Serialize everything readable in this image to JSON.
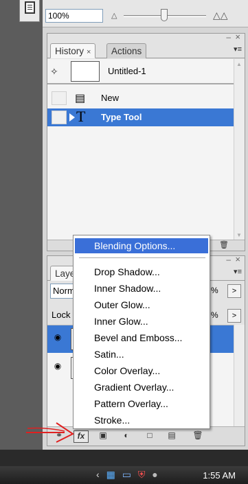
{
  "navigator": {
    "zoom_value": "100%",
    "zoom_out_icon": "mountain-small-icon",
    "zoom_in_icon": "mountain-large-icon"
  },
  "history_panel": {
    "tabs": [
      {
        "label": "History"
      },
      {
        "label": "Actions"
      }
    ],
    "snapshot_label": "Untitled-1",
    "items": [
      {
        "label": "New",
        "icon": "document-icon"
      },
      {
        "label": "Type Tool",
        "icon": "type-tool-icon",
        "selected": true
      }
    ]
  },
  "layers_panel": {
    "tab_label": "Laye",
    "blend_mode": "Norm",
    "opacity": "%",
    "lock_label": "Lock",
    "fill": "%"
  },
  "context_menu": {
    "items": [
      {
        "label": "Blending Options...",
        "highlighted": true
      },
      {
        "label": "Drop Shadow..."
      },
      {
        "label": "Inner Shadow..."
      },
      {
        "label": "Outer Glow..."
      },
      {
        "label": "Inner Glow..."
      },
      {
        "label": "Bevel and Emboss..."
      },
      {
        "label": "Satin..."
      },
      {
        "label": "Color Overlay..."
      },
      {
        "label": "Gradient Overlay..."
      },
      {
        "label": "Pattern Overlay..."
      },
      {
        "label": "Stroke..."
      }
    ]
  },
  "taskbar": {
    "clock": "1:55 AM"
  },
  "colors": {
    "selection_blue": "#3a78d4",
    "menu_highlight": "#3a6fd8",
    "annotation_red": "#e02020"
  }
}
